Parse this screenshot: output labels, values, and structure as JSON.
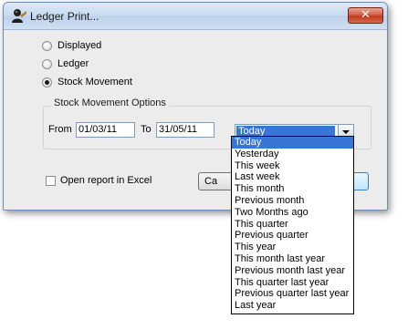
{
  "window": {
    "title": "Ledger Print...",
    "close_glyph": "✕"
  },
  "report_type": {
    "options": [
      "Displayed",
      "Ledger",
      "Stock Movement"
    ],
    "selected": "Stock Movement"
  },
  "stock_movement_options": {
    "group_label": "Stock Movement Options",
    "from_label": "From",
    "from_value": "01/03/11",
    "to_label": "To",
    "to_value": "31/05/11",
    "period_selected": "Today",
    "period_options": [
      "Today",
      "Yesterday",
      "This week",
      "Last week",
      "This month",
      "Previous month",
      "Two Months ago",
      "This quarter",
      "Previous quarter",
      "This year",
      "This month last year",
      "Previous month last year",
      "This quarter last year",
      "Previous quarter last year",
      "Last year"
    ]
  },
  "excel": {
    "label": "Open report in Excel",
    "checked": false
  },
  "buttons": {
    "cancel_label": "Ca"
  },
  "icons": {
    "title_icon": "person-icon",
    "close_icon": "close-icon",
    "dropdown_arrow": "chevron-down-icon"
  },
  "colors": {
    "selection": "#3875d7",
    "close_button": "#c8472b"
  }
}
